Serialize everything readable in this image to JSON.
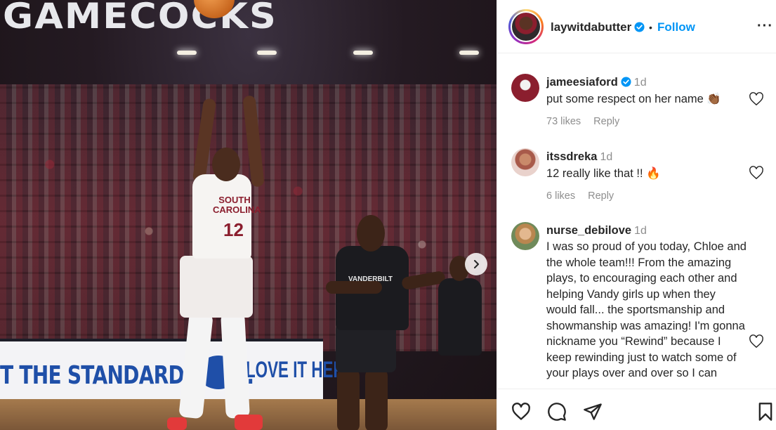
{
  "post": {
    "banner_text": "GAMECOCKS",
    "jersey_text": "SOUTH CAROLINA",
    "jersey_number": "12",
    "opponent_text": "VANDERBILT",
    "board_text": "T THE STANDARD HERE.",
    "board_text2": "LOVE IT HERE."
  },
  "header": {
    "username": "laywitdabutter",
    "separator": "•",
    "follow_label": "Follow",
    "more_label": "···"
  },
  "comments": [
    {
      "username": "jameesiaford",
      "verified": true,
      "time": "1d",
      "text": "put some respect on her name 👏🏾",
      "likes": "73 likes",
      "reply": "Reply"
    },
    {
      "username": "itssdreka",
      "verified": false,
      "time": "1d",
      "text": "12 really like that !! 🔥",
      "likes": "6 likes",
      "reply": "Reply"
    },
    {
      "username": "nurse_debilove",
      "verified": false,
      "time": "1d",
      "text": "I was so proud of you today, Chloe and the whole team!!! From the amazing plays, to encouraging each other and helping Vandy girls up when they would fall... the sportsmanship and showmanship was amazing! I'm gonna nickname you “Rewind” because I keep rewinding just to watch some of your plays over and over so I can"
    }
  ],
  "icons": {
    "verified": "verified-badge-icon",
    "like": "heart-icon",
    "comment": "comment-icon",
    "share": "share-icon",
    "save": "bookmark-icon",
    "next": "chevron-right-icon",
    "more": "more-options-icon"
  },
  "colors": {
    "link": "#0095f6",
    "verified": "#0095f6",
    "muted": "#8e8e8e"
  }
}
